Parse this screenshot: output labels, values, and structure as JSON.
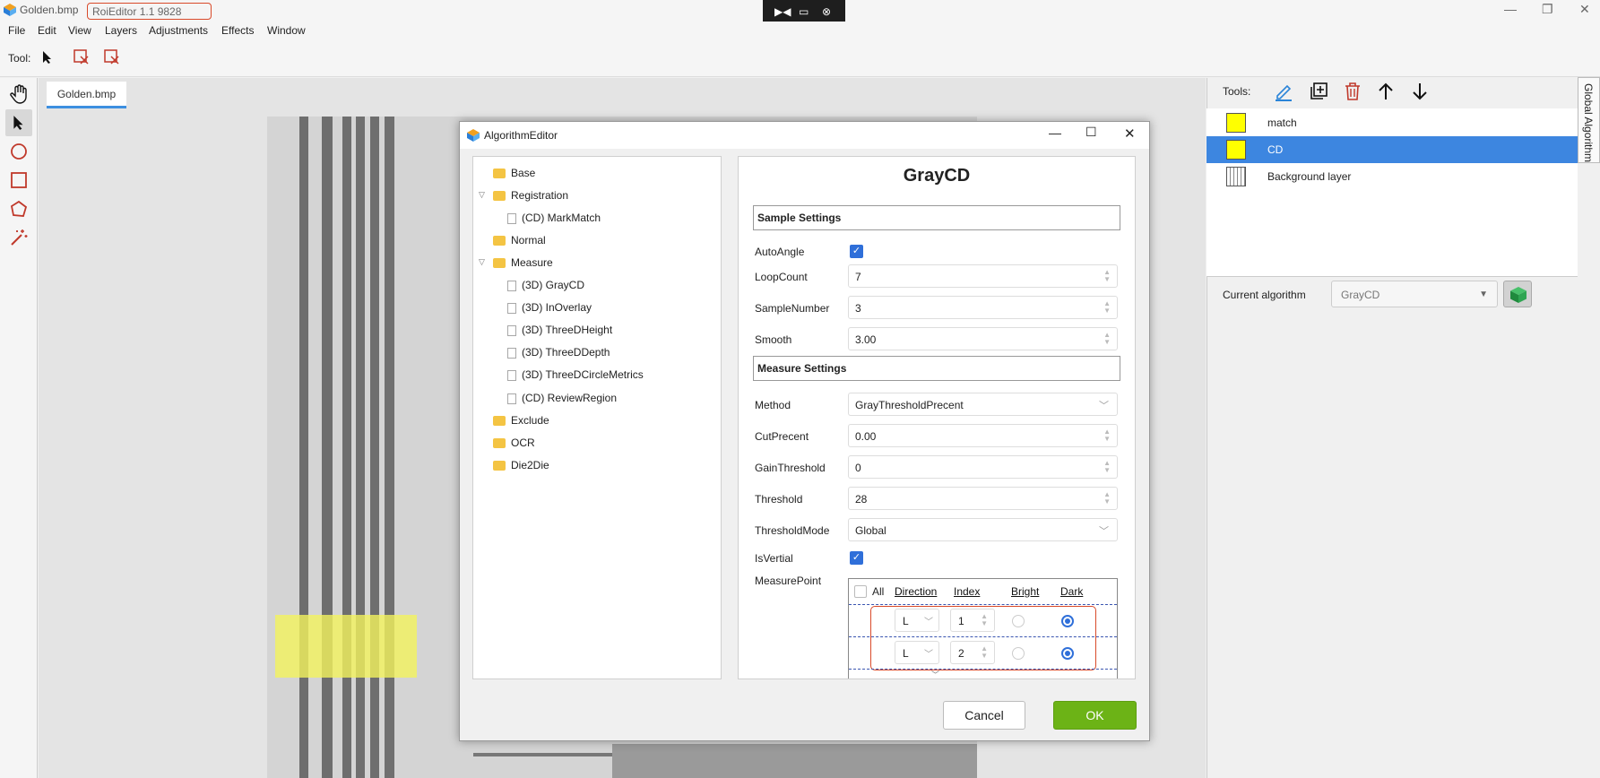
{
  "titlebar": {
    "doc_name": "Golden.bmp",
    "app_name": "RoiEditor 1.1 9828"
  },
  "menu": [
    "File",
    "Edit",
    "View",
    "Layers",
    "Adjustments",
    "Effects",
    "Window"
  ],
  "toolbar": {
    "tool_label": "Tool:"
  },
  "doc_tab": {
    "label": "Golden.bmp"
  },
  "right_panel": {
    "tools_label": "Tools:",
    "layers": [
      {
        "name": "match",
        "swatch": "#ffff00"
      },
      {
        "name": "CD",
        "swatch": "#ffff00",
        "selected": true
      },
      {
        "name": "Background layer",
        "swatch": "striped"
      }
    ],
    "current_algorithm_label": "Current algorithm",
    "current_algorithm_value": "GrayCD",
    "side_tab": "Global Algorithm"
  },
  "dialog": {
    "title": "AlgorithmEditor",
    "tree": [
      {
        "label": "Base",
        "kind": "folder",
        "level": 0
      },
      {
        "label": "Registration",
        "kind": "folder",
        "level": 0,
        "expanded": true
      },
      {
        "label": "(CD) MarkMatch",
        "kind": "file",
        "level": 1
      },
      {
        "label": "Normal",
        "kind": "folder",
        "level": 0
      },
      {
        "label": "Measure",
        "kind": "folder",
        "level": 0,
        "expanded": true
      },
      {
        "label": "(3D) GrayCD",
        "kind": "file",
        "level": 1
      },
      {
        "label": "(3D) InOverlay",
        "kind": "file",
        "level": 1
      },
      {
        "label": "(3D) ThreeDHeight",
        "kind": "file",
        "level": 1
      },
      {
        "label": "(3D) ThreeDDepth",
        "kind": "file",
        "level": 1
      },
      {
        "label": "(3D) ThreeDCircleMetrics",
        "kind": "file",
        "level": 1
      },
      {
        "label": "(CD) ReviewRegion",
        "kind": "file",
        "level": 1
      },
      {
        "label": "Exclude",
        "kind": "folder",
        "level": 0
      },
      {
        "label": "OCR",
        "kind": "folder",
        "level": 0
      },
      {
        "label": "Die2Die",
        "kind": "folder",
        "level": 0
      }
    ],
    "algorithm_name": "GrayCD",
    "sample_section": "Sample Settings",
    "auto_angle": {
      "label": "AutoAngle",
      "checked": true
    },
    "loop_count": {
      "label": "LoopCount",
      "value": "7"
    },
    "sample_number": {
      "label": "SampleNumber",
      "value": "3"
    },
    "smooth": {
      "label": "Smooth",
      "value": "3.00"
    },
    "measure_section": "Measure Settings",
    "method": {
      "label": "Method",
      "value": "GrayThresholdPrecent"
    },
    "cut_precent": {
      "label": "CutPrecent",
      "value": "0.00"
    },
    "gain_threshold": {
      "label": "GainThreshold",
      "value": "0"
    },
    "threshold": {
      "label": "Threshold",
      "value": "28"
    },
    "threshold_mode": {
      "label": "ThresholdMode",
      "value": "Global"
    },
    "is_vertial": {
      "label": "IsVertial",
      "checked": true
    },
    "measure_point": {
      "label": "MeasurePoint",
      "all_label": "All",
      "headers": {
        "direction": "Direction",
        "index": "Index",
        "bright": "Bright",
        "dark": "Dark"
      },
      "rows": [
        {
          "direction": "L",
          "index": "1",
          "bright": false,
          "dark": true
        },
        {
          "direction": "L",
          "index": "2",
          "bright": false,
          "dark": true
        }
      ]
    },
    "cancel_label": "Cancel",
    "ok_label": "OK"
  },
  "colors": {
    "accent": "#3d7ee0",
    "ok_button": "#6cb316",
    "highlight_border": "#d94a2a",
    "layer_selected": "#3d86e0"
  }
}
